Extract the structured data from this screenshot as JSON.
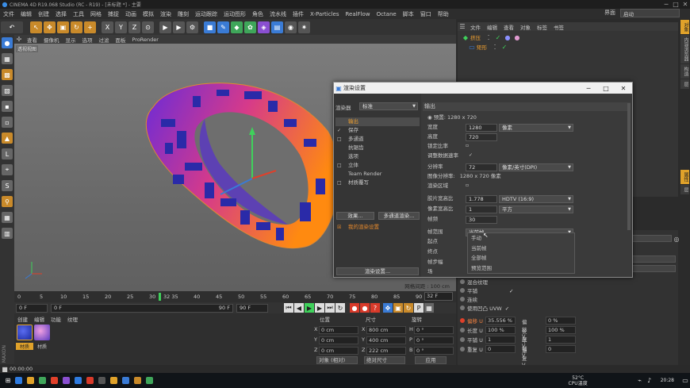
{
  "titlebar": {
    "title": "CINEMA 4D R19.068 Studio (RC - R19) - [未标题 *] - 主要"
  },
  "menu": [
    "文件",
    "编辑",
    "创建",
    "选择",
    "工具",
    "网格",
    "捕捉",
    "动画",
    "模拟",
    "渲染",
    "雕刻",
    "运动跟踪",
    "运动图形",
    "角色",
    "流水线",
    "插件",
    "X-Particles",
    "RealFlow",
    "Octane",
    "脚本",
    "窗口",
    "帮助"
  ],
  "layout": {
    "label": "界面",
    "value": "启动"
  },
  "viewport": {
    "menu": [
      "查看",
      "摄像机",
      "显示",
      "选项",
      "过滤",
      "面板",
      "ProRender"
    ],
    "label": "透视视图",
    "status": "网格间距 : 100 cm",
    "ring_text_color": "#2a2aa8",
    "gradient": [
      "#8a2be2",
      "#ff3b6b",
      "#ff8a00"
    ]
  },
  "timeline": {
    "ticks": [
      "0",
      "5",
      "10",
      "15",
      "20",
      "25",
      "30",
      "35",
      "40",
      "45",
      "50",
      "55",
      "60",
      "65",
      "70",
      "75",
      "80",
      "85",
      "90"
    ],
    "current": "32 35",
    "frame_field": "32 F",
    "start": "0 F",
    "start2": "0 F",
    "end": "90 F",
    "end2": "90 F"
  },
  "materials": {
    "menu": [
      "创建",
      "编辑",
      "功能",
      "纹理"
    ],
    "items": [
      {
        "label": "材质",
        "color": "#2a3ccf"
      },
      {
        "label": "材质",
        "color": "#c86fc9"
      }
    ]
  },
  "coords": {
    "headers": [
      "位置",
      "尺寸",
      "旋转"
    ],
    "rows": [
      {
        "axis": "X",
        "pos": "0 cm",
        "size": "800 cm",
        "rot_axis": "H",
        "rot": "0 °"
      },
      {
        "axis": "Y",
        "pos": "0 cm",
        "size": "400 cm",
        "rot_axis": "P",
        "rot": "0 °"
      },
      {
        "axis": "Z",
        "pos": "0 cm",
        "size": "222 cm",
        "rot_axis": "B",
        "rot": "0 °"
      }
    ],
    "mode1": "对象 (相对)",
    "mode2": "绝对尺寸",
    "apply": "应用"
  },
  "objects": {
    "menu": [
      "文件",
      "编辑",
      "查看",
      "对象",
      "标签",
      "书签"
    ],
    "items": [
      "挤压",
      "矩形"
    ]
  },
  "right_tabs": [
    "对象",
    "内容浏览器",
    "构造",
    "层"
  ],
  "right_tabs2": [
    "属性",
    "层"
  ],
  "attributes": {
    "rows": [
      {
        "label": "混合纹理",
        "value": ""
      },
      {
        "label": "平铺",
        "value": "✓"
      },
      {
        "label": "连续",
        "value": ""
      },
      {
        "label": "使用凹凸 UVW",
        "value": "✓"
      }
    ],
    "grid": [
      {
        "l1": "偏移 U",
        "v1": "35.556 %",
        "l2": "偏移 V",
        "v2": "0 %"
      },
      {
        "l1": "长度 U",
        "v1": "100 %",
        "l2": "长度 V",
        "v2": "100 %"
      },
      {
        "l1": "平铺 U",
        "v1": "1",
        "l2": "平铺 V",
        "v2": "1"
      },
      {
        "l1": "重复 U",
        "v1": "0",
        "l2": "重复 V",
        "v2": "0"
      }
    ]
  },
  "dialog": {
    "title": "渲染设置",
    "renderer_label": "渲染器",
    "renderer_value": "标准",
    "sections": [
      {
        "label": "输出",
        "check": "",
        "selected": true
      },
      {
        "label": "保存",
        "check": "✓",
        "selected": false
      },
      {
        "label": "多通道",
        "check": "□",
        "selected": false
      },
      {
        "label": "抗锯齿",
        "check": "",
        "selected": false
      },
      {
        "label": "选项",
        "check": "",
        "selected": false
      },
      {
        "label": "立体",
        "check": "□",
        "selected": false
      },
      {
        "label": "Team Render",
        "check": "",
        "selected": false
      },
      {
        "label": "材质覆写",
        "check": "□",
        "selected": false
      }
    ],
    "effects_btn": "效果...",
    "multipass_btn": "多通道渲染...",
    "my_setting": "我的渲染设置",
    "render_settings_btn": "渲染设置...",
    "output_header": "输出",
    "preset": "预置: 1280 x 720",
    "fields": {
      "width_label": "宽度",
      "width": "1280",
      "width_unit": "像素",
      "height_label": "高度",
      "height": "720",
      "lock_ratio": "锁定比率",
      "adapt_rate": "调整数据速率",
      "resolution_label": "分辨率",
      "resolution": "72",
      "resolution_unit": "像素/英寸(DPI)",
      "img_res_label": "图像分辨率:",
      "img_res": "1280 x 720 像素",
      "render_region": "渲染区域",
      "film_aspect_label": "胶片宽高比",
      "film_aspect": "1.778",
      "film_aspect_preset": "HDTV (16:9)",
      "pixel_aspect_label": "像素宽高比",
      "pixel_aspect": "1",
      "pixel_aspect_preset": "平方",
      "fps_label": "帧频",
      "fps": "30",
      "frame_range_label": "帧范围",
      "frame_range": "当前帧",
      "start_label": "起点",
      "end_label": "终点",
      "step_label": "帧步幅",
      "field_label": "场"
    },
    "dropdown": [
      "手动",
      "当前帧",
      "全部帧",
      "预览范围"
    ]
  },
  "statusbar": {
    "time": "00:00:00"
  },
  "taskbar": {
    "temp": "52°C",
    "cpu": "CPU温度",
    "clock": "20:28"
  }
}
